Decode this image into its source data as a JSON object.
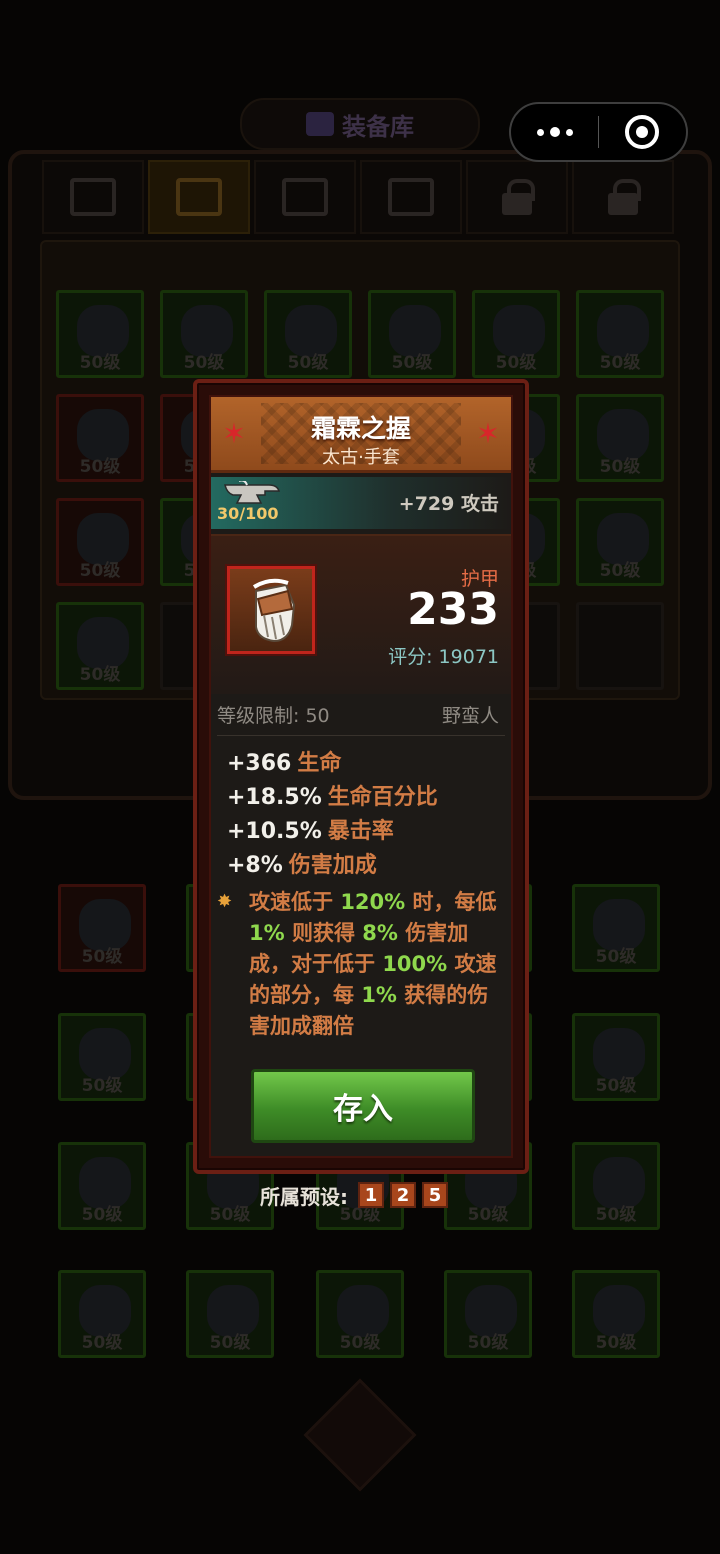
{
  "background": {
    "title": "装备库",
    "slot_level_label": "50级"
  },
  "capsule": {
    "more_icon": "more-dots-icon",
    "close_icon": "target-circle-icon"
  },
  "item": {
    "name": "霜霖之握",
    "subtitle": "太古·手套",
    "forge_progress": "30/100",
    "forge_bonus": "+729 攻击",
    "armor_label": "护甲",
    "armor_value": "233",
    "score_text": "评分: 19071",
    "level_req": "等级限制: 50",
    "class": "野蛮人",
    "stats": [
      {
        "value": "+366",
        "name": "生命"
      },
      {
        "value": "+18.5%",
        "name": "生命百分比"
      },
      {
        "value": "+10.5%",
        "name": "暴击率"
      },
      {
        "value": "+8%",
        "name": "伤害加成"
      }
    ],
    "special": {
      "p1": "攻速低于 ",
      "h1": "120%",
      "p2": " 时，每低 ",
      "h2": "1%",
      "p3": " 则获得 ",
      "h3": "8%",
      "p4": " 伤害加成，对于低于 ",
      "h4": "100%",
      "p5": " 攻速的部分，每 ",
      "h5": "1%",
      "p6": " 获得的伤害加成翻倍"
    },
    "save_button": "存入"
  },
  "preset": {
    "label": "所属预设:",
    "numbers": [
      "1",
      "2",
      "5"
    ]
  },
  "colors": {
    "header": "#b2642a",
    "frame": "#6b1f14",
    "stat_name": "#d27c45",
    "highlight": "#8fd84d",
    "button": "#3e8c27"
  }
}
